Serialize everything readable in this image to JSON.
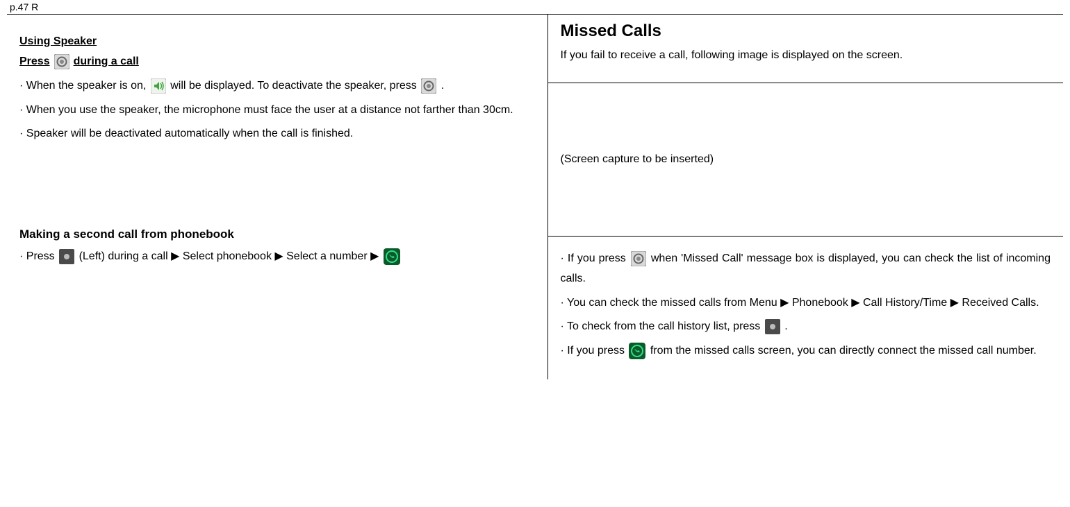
{
  "page_label": "p.47 R",
  "left": {
    "heading1": "Using Speaker",
    "press_prefix": "Press",
    "press_suffix": "during a call",
    "b1a": "· When the speaker is on,",
    "b1b": "will be displayed. To deactivate the speaker, press",
    "b1c": ".",
    "b2": "· When you use the speaker, the microphone must face the user at a distance not farther than 30cm.",
    "b3": "· Speaker will be deactivated automatically when the call is finished.",
    "heading2": "Making a second call from phonebook",
    "pb_a": "· Press",
    "pb_b": "(Left) during a call ▶ Select phonebook ▶ Select a number ▶"
  },
  "right": {
    "title": "Missed Calls",
    "intro": "If you fail to receive a call, following image is displayed on the screen.",
    "placeholder": "(Screen capture to be inserted)",
    "c1a": "· If you press",
    "c1b": "when 'Missed Call' message box is displayed, you can check the list of incoming calls.",
    "c2": "· You can check the missed calls from Menu ▶ Phonebook ▶ Call History/Time ▶ Received Calls.",
    "c3a": "· To check from the call history list, press",
    "c3b": ".",
    "c4a": "· If you press",
    "c4b": "from the missed calls screen, you can directly connect the missed call number."
  }
}
